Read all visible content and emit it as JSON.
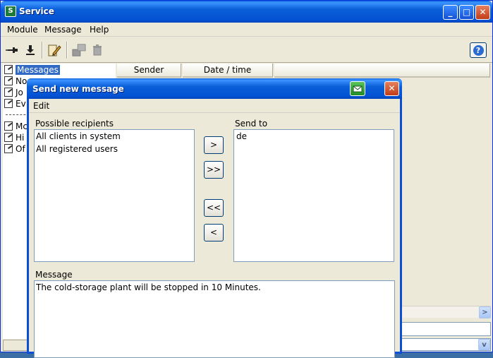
{
  "window": {
    "title": "Service",
    "icon": "app-icon",
    "buttons": {
      "minimize": "_",
      "maximize": "□",
      "close": "✕"
    }
  },
  "menu": [
    "Module",
    "Message",
    "Help"
  ],
  "toolbar": {
    "icons": [
      "pin-icon",
      "download-icon",
      "edit-pencil-icon",
      "forward-icon",
      "trash-icon"
    ],
    "help_icon": "help-icon",
    "help_glyph": "?"
  },
  "tree": {
    "items": [
      {
        "label": "Messages",
        "selected": true
      },
      {
        "label": "No",
        "selected": false
      },
      {
        "label": "Jo",
        "selected": false
      },
      {
        "label": "Ev",
        "selected": false
      },
      {
        "label": "Mc",
        "selected": false
      },
      {
        "label": "Hi",
        "selected": false
      },
      {
        "label": "Of",
        "selected": false
      }
    ]
  },
  "table": {
    "columns": [
      "Sender",
      "Date / time"
    ]
  },
  "dialog": {
    "title": "Send new message",
    "menu": [
      "Edit"
    ],
    "possible_recipients_label": "Possible recipients",
    "possible_recipients": [
      "All clients in system",
      "All registered users"
    ],
    "send_to_label": "Send to",
    "send_to": [
      "de"
    ],
    "buttons": {
      "add": ">",
      "add_all": ">>",
      "remove_all": "<<",
      "remove": "<"
    },
    "message_label": "Message",
    "message_text": "The cold-storage plant will be stopped in 10 Minutes."
  }
}
